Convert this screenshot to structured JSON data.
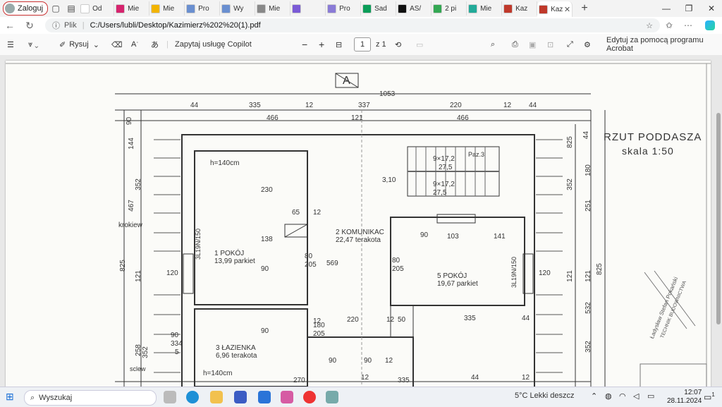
{
  "browser": {
    "profile_label": "Zaloguj",
    "tabs": [
      {
        "label": "Od",
        "color": "#ffffff",
        "icon": "gmail-icon"
      },
      {
        "label": "Mie",
        "color": "#d6246e",
        "icon": "diamond-icon"
      },
      {
        "label": "Mie",
        "color": "#f2b400",
        "icon": "home-icon"
      },
      {
        "label": "Pro",
        "color": "#6a8fd0",
        "icon": "chart-icon"
      },
      {
        "label": "Wy",
        "color": "#6a8fd0",
        "icon": "chart-icon"
      },
      {
        "label": "Mie",
        "color": "#888888",
        "icon": "s-icon"
      },
      {
        "label": "",
        "color": "#7b5bd6",
        "icon": "speaker-icon"
      },
      {
        "label": "Pro",
        "color": "#8a7bd6",
        "icon": "shield-icon"
      },
      {
        "label": "Sad",
        "color": "#0a9d58",
        "icon": "s-icon"
      },
      {
        "label": "AS/",
        "color": "#111111",
        "icon": "a-icon"
      },
      {
        "label": "2 pi",
        "color": "#34a853",
        "icon": "square-icon"
      },
      {
        "label": "Mie",
        "color": "#22aa99",
        "icon": "oto-icon"
      },
      {
        "label": "Kaz",
        "color": "#c0392b",
        "icon": "pdf-icon"
      },
      {
        "label": "Kaz",
        "color": "#c0392b",
        "icon": "pdf-icon"
      }
    ],
    "url_prefix": "Plik",
    "url": "C:/Users/lubli/Desktop/Kazimierz%202%20(1).pdf"
  },
  "pdf_toolbar": {
    "draw_label": "Rysuj",
    "copilot_label": "Zapytaj usługę Copilot",
    "page_current": "1",
    "page_total": "z 1",
    "edit_acrobat_label": "Edytuj za pomocą programu Acrobat"
  },
  "drawing": {
    "title": "RZUT PODDASZA",
    "scale": "skala 1:50",
    "section_mark": "A",
    "rooms": [
      {
        "num": "1",
        "name": "POKÓJ",
        "area": "13,99",
        "finish": "parkiet"
      },
      {
        "num": "2",
        "name": "KOMUNIKAC",
        "area": "22,47",
        "finish": "terakota"
      },
      {
        "num": "3",
        "name": "ŁAZIENKA",
        "area": "6,96",
        "finish": "terakota"
      },
      {
        "num": "5",
        "name": "POKÓJ",
        "area": "19,67",
        "finish": "parkiet"
      }
    ],
    "notes": {
      "h1": "h=140cm",
      "h2": "h=140cm",
      "krokiew": "krokiew",
      "sciew": "sclew",
      "stairs1": "9×17,2",
      "stairs1b": "27,5",
      "stairs2": "9×17,2",
      "stairs2b": "27,5",
      "paz": "Paz.3",
      "level": "3,10",
      "win1": "3L19N/150",
      "win2": "3L19N/150",
      "stamp1": "Ładysław Stefan Pokański",
      "stamp2": "TECHNIK BUDOWNICTWA"
    },
    "dims_top": [
      "44",
      "335",
      "12",
      "337",
      "220",
      "12",
      "44",
      "1053",
      "466",
      "121",
      "466"
    ],
    "dims_left": [
      "90",
      "144",
      "352",
      "467",
      "121",
      "825",
      "258",
      "352"
    ],
    "dims_right": [
      "825",
      "180",
      "352",
      "251",
      "825",
      "44",
      "121",
      "121",
      "532",
      "352"
    ],
    "dims_inner": [
      "230",
      "65",
      "12",
      "138",
      "80",
      "205",
      "90",
      "120",
      "569",
      "90",
      "80",
      "205",
      "103",
      "141",
      "120",
      "12",
      "180",
      "205",
      "220",
      "12",
      "50",
      "335",
      "44",
      "90",
      "90",
      "90",
      "12",
      "270",
      "12",
      "335",
      "44",
      "12",
      "90",
      "334",
      "5"
    ]
  },
  "taskbar": {
    "search_placeholder": "Wyszukaj",
    "weather": "5°C  Lekki deszcz",
    "time": "12:07",
    "date": "28.11.2024",
    "notification_count": "1"
  }
}
